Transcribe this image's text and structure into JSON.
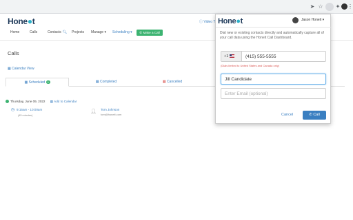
{
  "app": {
    "logo": {
      "pre": "Hone",
      "accent": "",
      "post": "t"
    },
    "video_tutorials": "Video T",
    "nav": {
      "home": "Home",
      "calls": "Calls",
      "contacts": "Contacts",
      "projects": "Projects",
      "manage": "Manage",
      "scheduling": "Scheduling",
      "make_call": "Make a Call"
    },
    "page_title": "Calls",
    "calendar_view": "Calendar View",
    "tabs": [
      {
        "label": "Scheduled",
        "badge": "1"
      },
      {
        "label": "Completed"
      },
      {
        "label": "Cancelled"
      }
    ],
    "date_row": {
      "date": "Thursday, June 09, 2022",
      "add_to_calendar": "Add to Calendar"
    },
    "call": {
      "time": "9:15am - 10:00am",
      "duration": "(45 minutes)",
      "contact_name": "Tom Johnson",
      "contact_email": "tom@honeit.com"
    }
  },
  "popup": {
    "logo": {
      "pre": "Hone",
      "post": "t"
    },
    "user_name": "Jason Honeit",
    "description": "Dial new or existing contacts directly and automatically capture all of your call data using the Honeit Call Dashboard.",
    "country_code": "+1",
    "phone_value": "(415) 555-5555",
    "phone_note": "(Dials limited to United States and Canada only)",
    "name_value": "Jill Candidate",
    "email_placeholder": "Enter Email (optional)",
    "cancel_label": "Cancel",
    "call_label": "Call"
  },
  "colors": {
    "accent": "#3a7fc1",
    "brand_dark": "#1f3a5a",
    "brand_teal": "#2bb0c9",
    "green": "#3cb371",
    "red_note": "#d9534f"
  }
}
